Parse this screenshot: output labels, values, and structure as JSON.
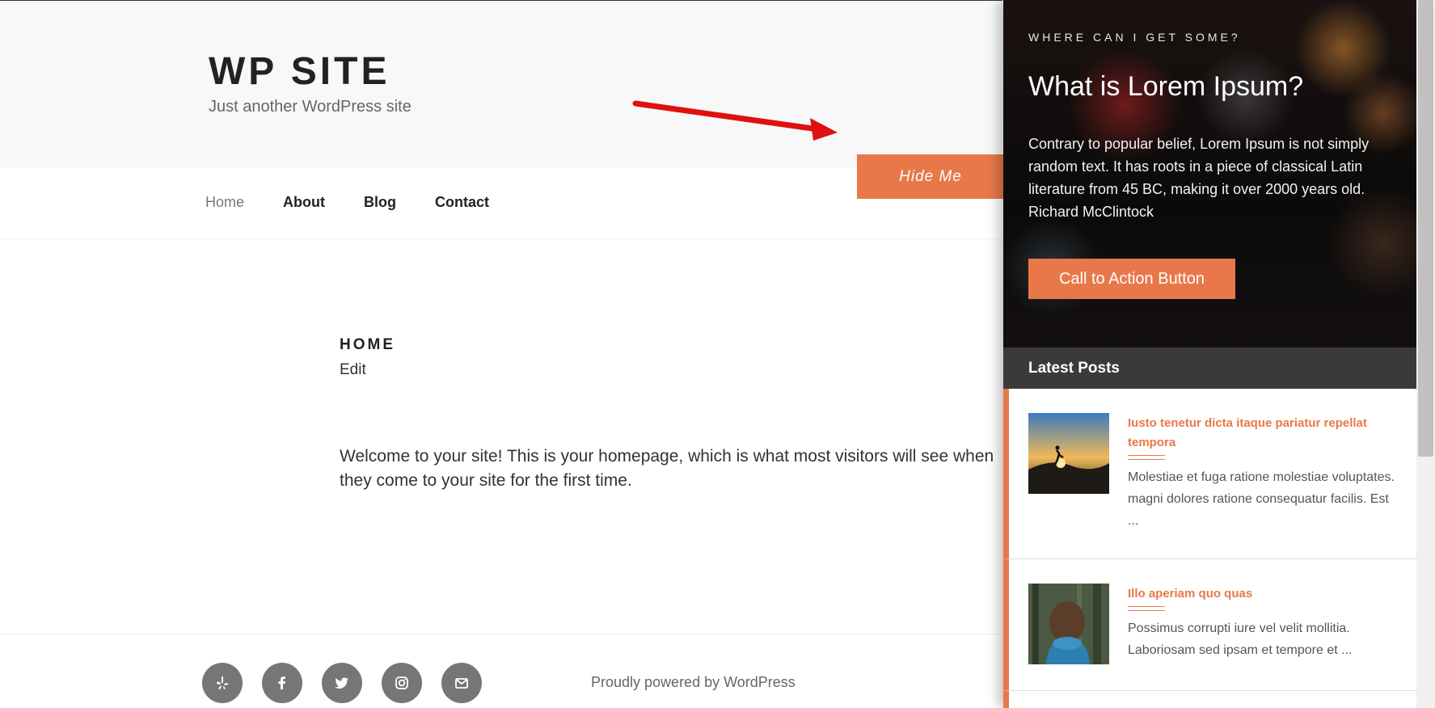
{
  "site": {
    "title": "WP SITE",
    "description": "Just another WordPress site"
  },
  "nav": {
    "items": [
      {
        "label": "Home",
        "current": true
      },
      {
        "label": "About"
      },
      {
        "label": "Blog"
      },
      {
        "label": "Contact"
      }
    ]
  },
  "hide_button": {
    "label": "Hide Me"
  },
  "content": {
    "heading": "HOME",
    "edit_label": "Edit",
    "welcome": "Welcome to your site! This is your homepage, which is what most visitors will see when they come to your site for the first time."
  },
  "footer": {
    "social_icons": [
      "yelp-icon",
      "facebook-icon",
      "twitter-icon",
      "instagram-icon",
      "envelope-icon"
    ],
    "powered_by": "Proudly powered by WordPress"
  },
  "panel": {
    "eyebrow": "WHERE CAN I GET SOME?",
    "title": "What is Lorem Ipsum?",
    "text": "Contrary to popular belief, Lorem Ipsum is not simply random text. It has roots in a piece of classical Latin literature from 45 BC, making it over 2000 years old. Richard McClintock",
    "cta_label": "Call to Action Button",
    "posts_heading": "Latest Posts",
    "posts": [
      {
        "title": "Iusto tenetur dicta itaque pariatur repellat tempora",
        "excerpt": "Molestiae et fuga ratione molestiae voluptates. magni dolores ratione consequatur facilis. Est ..."
      },
      {
        "title": "Illo aperiam quo quas",
        "excerpt": "Possimus corrupti iure vel velit mollitia. Laboriosam sed ipsam et tempore et ..."
      }
    ]
  },
  "colors": {
    "accent": "#e8784a",
    "posts_header": "#3a3a3a",
    "icon_circle": "#767676"
  }
}
